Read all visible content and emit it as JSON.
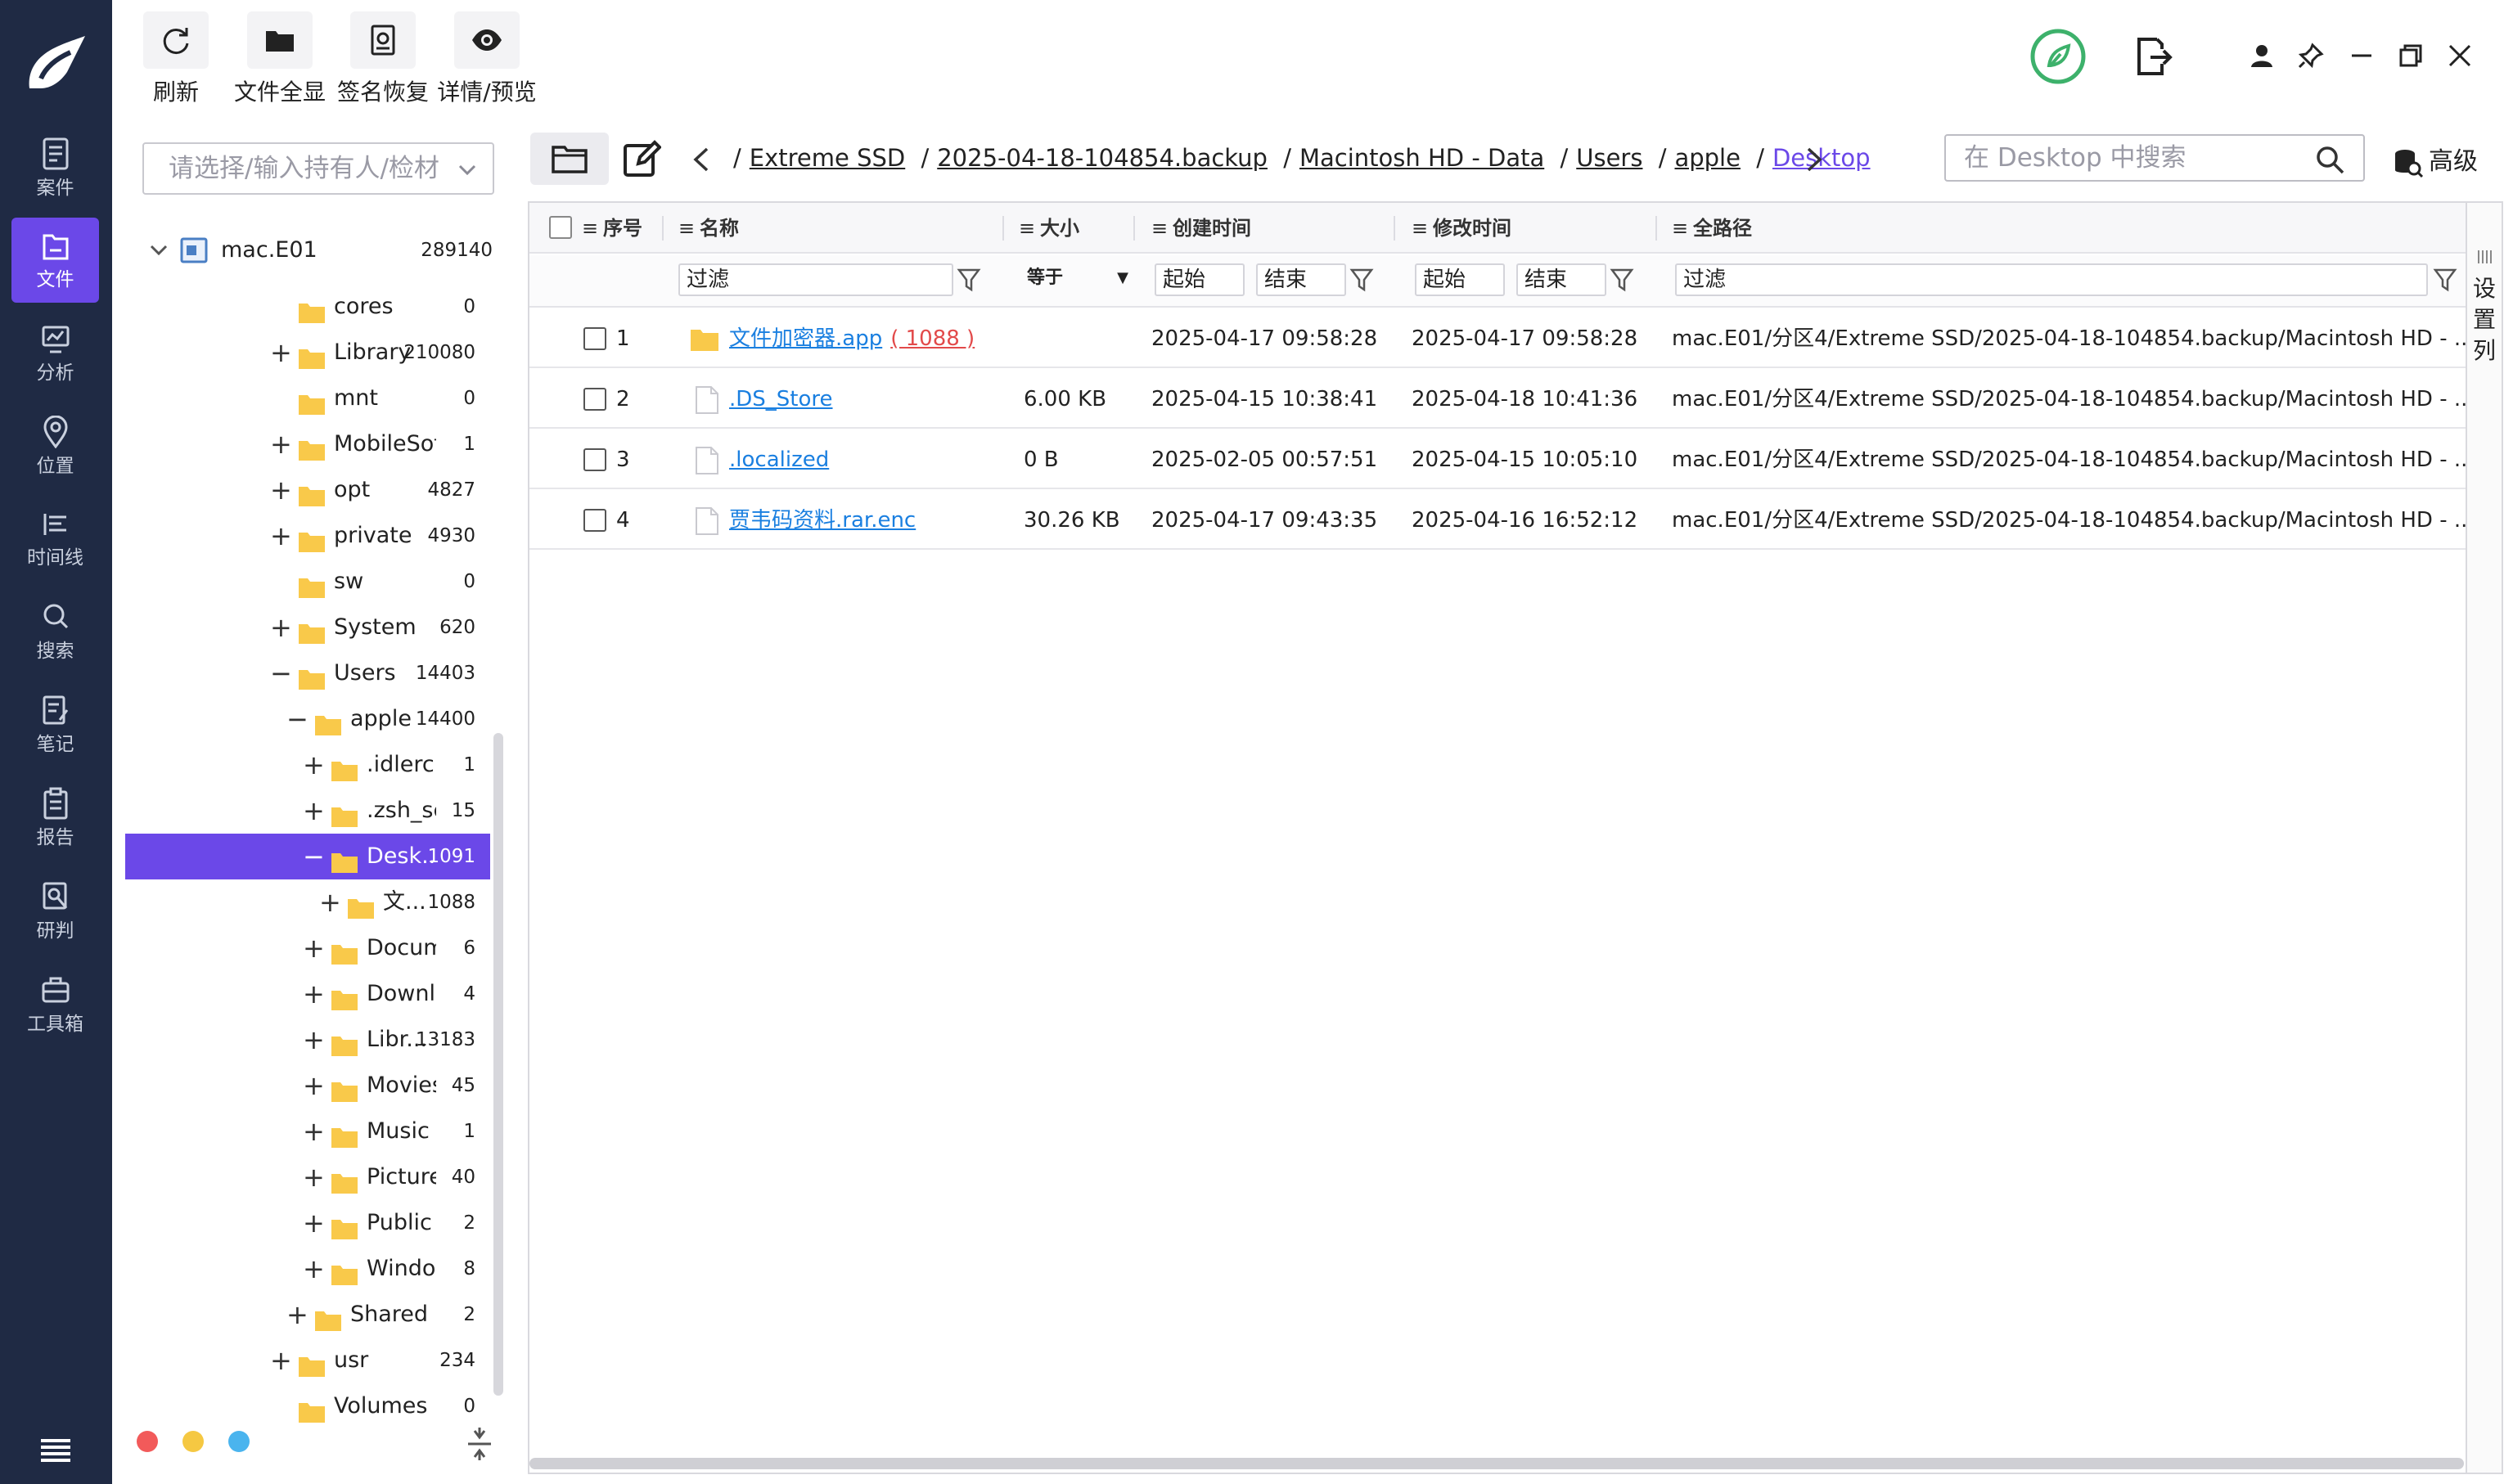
{
  "toolbar": {
    "refresh": "刷新",
    "show_all_files": "文件全显",
    "signature_recovery": "签名恢复",
    "detail_preview": "详情/预览"
  },
  "nav": {
    "items": [
      "案件",
      "文件",
      "分析",
      "位置",
      "时间线",
      "搜索",
      "笔记",
      "报告",
      "研判",
      "工具箱"
    ],
    "active": "文件"
  },
  "tree": {
    "owner_placeholder": "请选择/输入持有人/检材",
    "root": {
      "name": "mac.E01",
      "count": "289140"
    },
    "nodes": [
      {
        "toggle": "",
        "name": "cores",
        "count": "0"
      },
      {
        "toggle": "+",
        "name": "Library",
        "count": "210080"
      },
      {
        "toggle": "",
        "name": "mnt",
        "count": "0"
      },
      {
        "toggle": "+",
        "name": "MobileSoft...",
        "count": "1"
      },
      {
        "toggle": "+",
        "name": "opt",
        "count": "4827"
      },
      {
        "toggle": "+",
        "name": "private",
        "count": "4930"
      },
      {
        "toggle": "",
        "name": "sw",
        "count": "0"
      },
      {
        "toggle": "+",
        "name": "System",
        "count": "620"
      },
      {
        "toggle": "−",
        "name": "Users",
        "count": "14403"
      },
      {
        "toggle": "−",
        "name": "apple",
        "count": "14400"
      },
      {
        "toggle": "+",
        "name": ".idlerc",
        "count": "1"
      },
      {
        "toggle": "+",
        "name": ".zsh_se...",
        "count": "15"
      },
      {
        "toggle": "−",
        "name": "Desk...",
        "count": "1091"
      },
      {
        "toggle": "+",
        "name": "文...",
        "count": "1088"
      },
      {
        "toggle": "+",
        "name": "Docume...",
        "count": "6"
      },
      {
        "toggle": "+",
        "name": "Downlo...",
        "count": "4"
      },
      {
        "toggle": "+",
        "name": "Libr...",
        "count": "13183"
      },
      {
        "toggle": "+",
        "name": "Movies",
        "count": "45"
      },
      {
        "toggle": "+",
        "name": "Music",
        "count": "1"
      },
      {
        "toggle": "+",
        "name": "Pictures",
        "count": "40"
      },
      {
        "toggle": "+",
        "name": "Public",
        "count": "2"
      },
      {
        "toggle": "+",
        "name": "Window...",
        "count": "8"
      },
      {
        "toggle": "+",
        "name": "Shared",
        "count": "2"
      },
      {
        "toggle": "+",
        "name": "usr",
        "count": "234"
      },
      {
        "toggle": "",
        "name": "Volumes",
        "count": "0"
      }
    ]
  },
  "path": {
    "segments": [
      "Extreme SSD",
      "2025-04-18-104854.backup",
      "Macintosh HD - Data",
      "Users",
      "apple",
      "Desktop"
    ]
  },
  "search": {
    "placeholder": "在 Desktop 中搜索"
  },
  "advanced_label": "高级",
  "grid": {
    "headers": {
      "index": "序号",
      "name": "名称",
      "size": "大小",
      "created": "创建时间",
      "modified": "修改时间",
      "fullpath": "全路径"
    },
    "filters": {
      "name": "过滤",
      "size_op": "等于",
      "start": "起始",
      "end": "结束",
      "path": "过滤"
    },
    "settings_label": "设置列",
    "rows": [
      {
        "index": "1",
        "name": "文件加密器.app",
        "child_count": "( 1088 )",
        "size": "",
        "created": "2025-04-17 09:58:28",
        "modified": "2025-04-17 09:58:28",
        "path": "mac.E01/分区4/Extreme SSD/2025-04-18-104854.backup/Macintosh HD - ..."
      },
      {
        "index": "2",
        "name": ".DS_Store",
        "size": "6.00 KB",
        "created": "2025-04-15 10:38:41",
        "modified": "2025-04-18 10:41:36",
        "path": "mac.E01/分区4/Extreme SSD/2025-04-18-104854.backup/Macintosh HD - ..."
      },
      {
        "index": "3",
        "name": ".localized",
        "size": "0 B",
        "created": "2025-02-05 00:57:51",
        "modified": "2025-04-15 10:05:10",
        "path": "mac.E01/分区4/Extreme SSD/2025-04-18-104854.backup/Macintosh HD - ..."
      },
      {
        "index": "4",
        "name": "贾韦码资料.rar.enc",
        "size": "30.26 KB",
        "created": "2025-04-17 09:43:35",
        "modified": "2025-04-16 16:52:12",
        "path": "mac.E01/分区4/Extreme SSD/2025-04-18-104854.backup/Macintosh HD - ..."
      }
    ]
  },
  "colors": {
    "nav_bg": "#1f2a44",
    "accent": "#6b48e8",
    "link": "#1a7fe0",
    "folder": "#f9c94a",
    "count_red": "#e24a4a",
    "status_green": "#3db16b"
  }
}
